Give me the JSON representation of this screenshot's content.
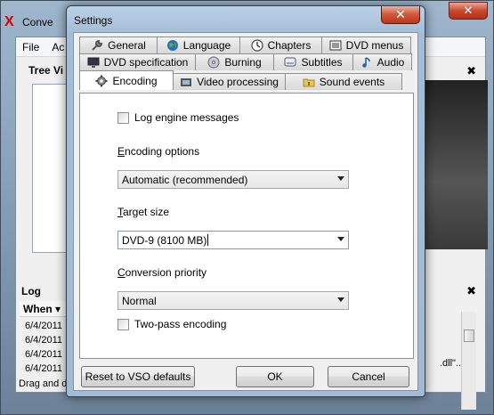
{
  "main_window": {
    "logo": "X",
    "title": "Conve",
    "close_glyph": "✕",
    "menu": [
      "File",
      "Ac"
    ],
    "tree_view_label": "Tree Vi",
    "panel_close_glyph": "✖",
    "log_label": "Log",
    "log_column_when": "When",
    "log_rows": [
      "6/4/2011",
      "6/4/2011",
      "6/4/2011",
      "6/4/2011"
    ],
    "log_right_text": ".dll\"...",
    "status_text": "Drag and d"
  },
  "dialog": {
    "title": "Settings",
    "close_glyph": "✕",
    "tabs_row1": [
      {
        "label": "General",
        "icon": "wrench-icon"
      },
      {
        "label": "Language",
        "icon": "globe-icon"
      },
      {
        "label": "Chapters",
        "icon": "clock-icon"
      },
      {
        "label": "DVD menus",
        "icon": "menu-list-icon"
      }
    ],
    "tabs_row2": [
      {
        "label": "DVD specification",
        "icon": "monitor-icon"
      },
      {
        "label": "Burning",
        "icon": "disc-icon"
      },
      {
        "label": "Subtitles",
        "icon": "subtitles-icon"
      },
      {
        "label": "Audio",
        "icon": "music-note-icon"
      }
    ],
    "tabs_row3": [
      {
        "label": "Encoding",
        "icon": "gear-icon",
        "active": true
      },
      {
        "label": "Video processing",
        "icon": "film-icon"
      },
      {
        "label": "Sound events",
        "icon": "folder-sound-icon"
      }
    ],
    "encoding": {
      "log_engine_messages": {
        "label": "Log engine messages",
        "checked": false
      },
      "encoding_options": {
        "label_first": "E",
        "label_rest": "ncoding options",
        "value": "Automatic (recommended)"
      },
      "target_size": {
        "label_first": "T",
        "label_rest": "arget size",
        "value": "DVD-9 (8100 MB)"
      },
      "conversion_priority": {
        "label_first": "C",
        "label_rest": "onversion priority",
        "value": "Normal"
      },
      "two_pass": {
        "label": "Two-pass encoding",
        "checked": false
      }
    },
    "buttons": {
      "reset": "Reset to VSO defaults",
      "ok": "OK",
      "cancel": "Cancel"
    }
  }
}
